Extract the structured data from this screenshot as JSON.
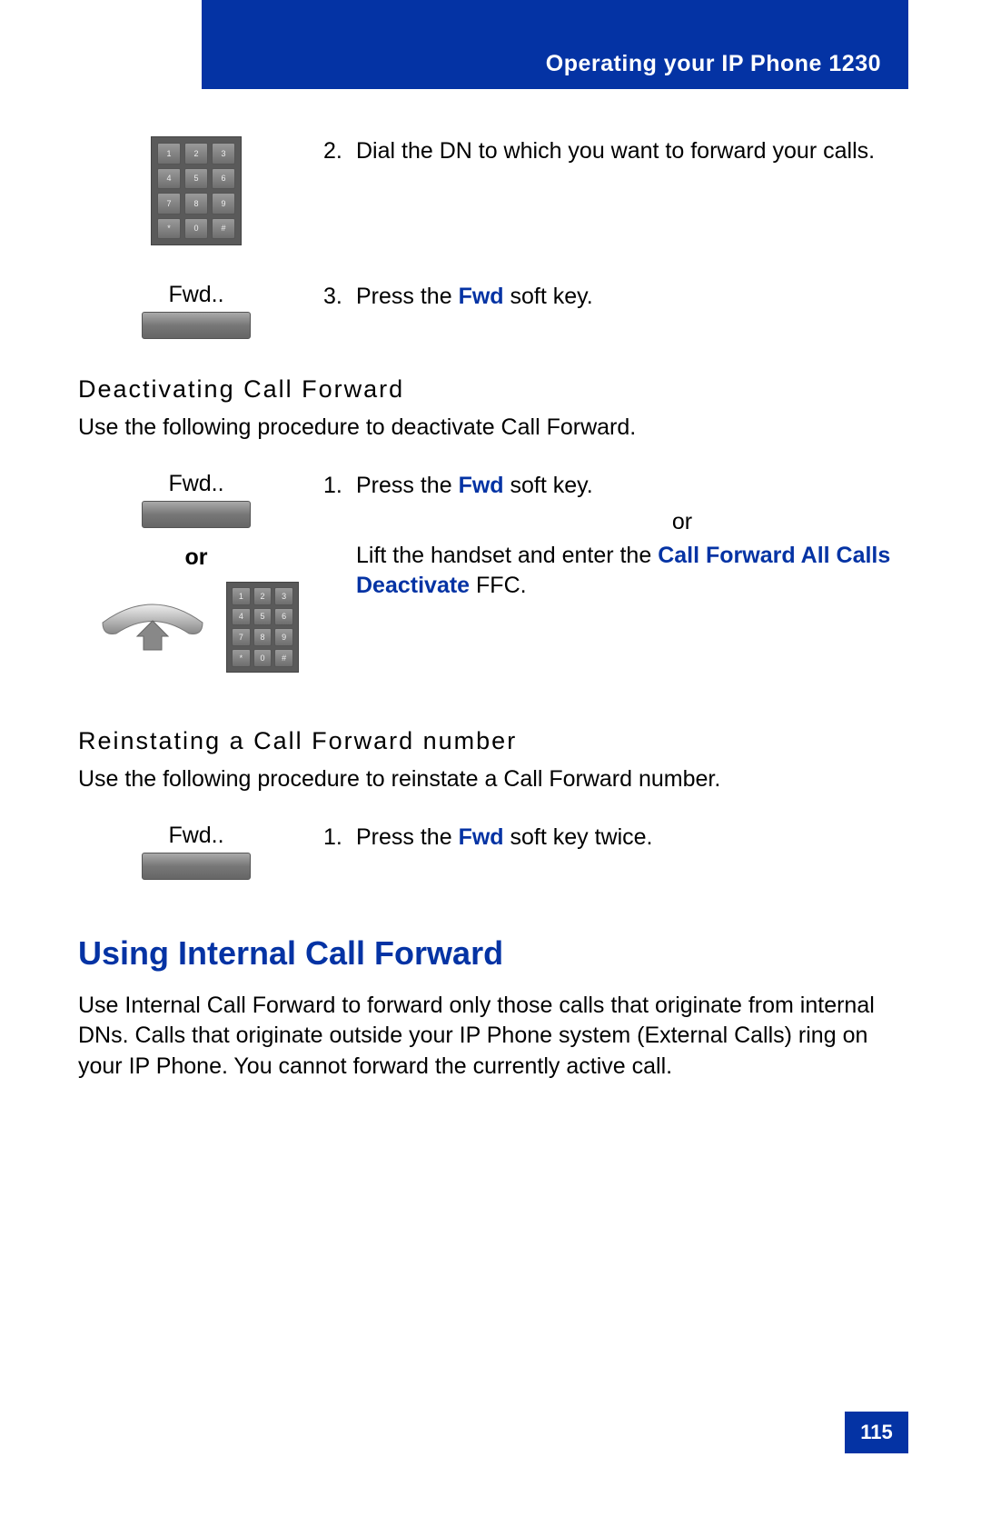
{
  "header": {
    "title": "Operating your IP Phone 1230"
  },
  "keypad": {
    "keys": [
      "1",
      "2",
      "3",
      "4",
      "5",
      "6",
      "7",
      "8",
      "9",
      "*",
      "0",
      "#"
    ]
  },
  "step2": {
    "num": "2.",
    "text": "Dial the DN to which you want to forward your calls."
  },
  "fwd_label": "Fwd..",
  "step3": {
    "num": "3.",
    "pre": "Press the ",
    "key": "Fwd",
    "post": " soft key."
  },
  "deactivate": {
    "heading": "Deactivating Call Forward",
    "intro": "Use the following procedure to deactivate Call Forward.",
    "step1": {
      "num": "1.",
      "pre": "Press the ",
      "key": "Fwd",
      "post": " soft key."
    },
    "or": "or",
    "or_left": "or",
    "alt_pre": "Lift the handset and enter the ",
    "alt_key": "Call Forward All Calls Deactivate",
    "alt_post": " FFC."
  },
  "reinstate": {
    "heading": "Reinstating a Call Forward number",
    "intro": "Use the following procedure to reinstate a Call Forward number.",
    "step1": {
      "num": "1.",
      "pre": "Press the ",
      "key": "Fwd",
      "post": " soft key twice."
    }
  },
  "internal": {
    "heading": "Using Internal Call Forward",
    "body": "Use Internal Call Forward to forward only those calls that originate from internal DNs. Calls that originate outside your IP Phone system (External Calls) ring on your IP Phone. You cannot forward the currently active call."
  },
  "page_number": "115"
}
